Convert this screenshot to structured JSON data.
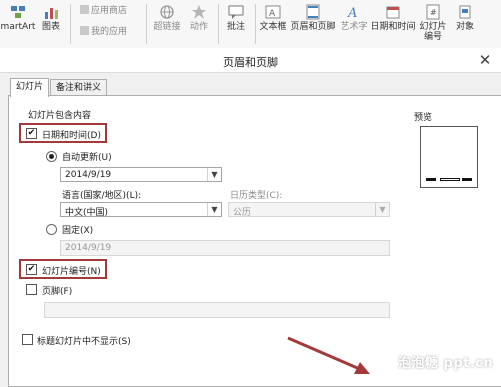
{
  "ribbon": {
    "smartart_label": "martArt",
    "chart_label": "图表",
    "app_store_label": "应用商店",
    "my_apps_label": "我的应用",
    "hyperlink_label": "超链接",
    "action_label": "动作",
    "comment_label": "批注",
    "textbox_label": "文本框",
    "header_footer_label": "页眉和页脚",
    "wordart_label": "艺术字",
    "datetime_label": "日期和时间",
    "slide_number_label_1": "幻灯片",
    "slide_number_label_2": "编号",
    "object_label": "对象"
  },
  "dialog": {
    "title": "页眉和页脚",
    "close_glyph": "✕",
    "tabs": [
      {
        "label": "幻灯片"
      },
      {
        "label": "备注和讲义"
      }
    ],
    "group_label": "幻灯片包含内容",
    "datetime": {
      "label": "日期和时间(D)",
      "checked": true
    },
    "auto_update": {
      "label": "自动更新(U)",
      "selected": true,
      "value": "2014/9/19"
    },
    "language": {
      "label": "语言(国家/地区)(L):",
      "value": "中文(中国)"
    },
    "calendar": {
      "label": "日历类型(C):",
      "value": "公历"
    },
    "fixed": {
      "label": "固定(X)",
      "selected": false,
      "value": "2014/9/19"
    },
    "slide_number": {
      "label": "幻灯片编号(N)",
      "checked": true
    },
    "footer": {
      "label": "页脚(F)",
      "checked": false,
      "value": ""
    },
    "hide_on_title": {
      "label": "标题幻灯片中不显示(S)",
      "checked": false
    },
    "preview_label": "预览"
  },
  "watermark": "泡泡糖 ppt.cn",
  "colors": {
    "highlight": "#a23a3a",
    "arrow": "#a23a3a"
  },
  "icons": [
    "smartart-icon",
    "chart-icon",
    "store-icon",
    "apps-icon",
    "hyperlink-icon",
    "action-icon",
    "comment-icon",
    "textbox-icon",
    "header-footer-icon",
    "wordart-icon",
    "datetime-icon",
    "slide-number-icon",
    "object-icon",
    "checkmark-icon",
    "dropdown-arrow-icon",
    "close-icon"
  ]
}
